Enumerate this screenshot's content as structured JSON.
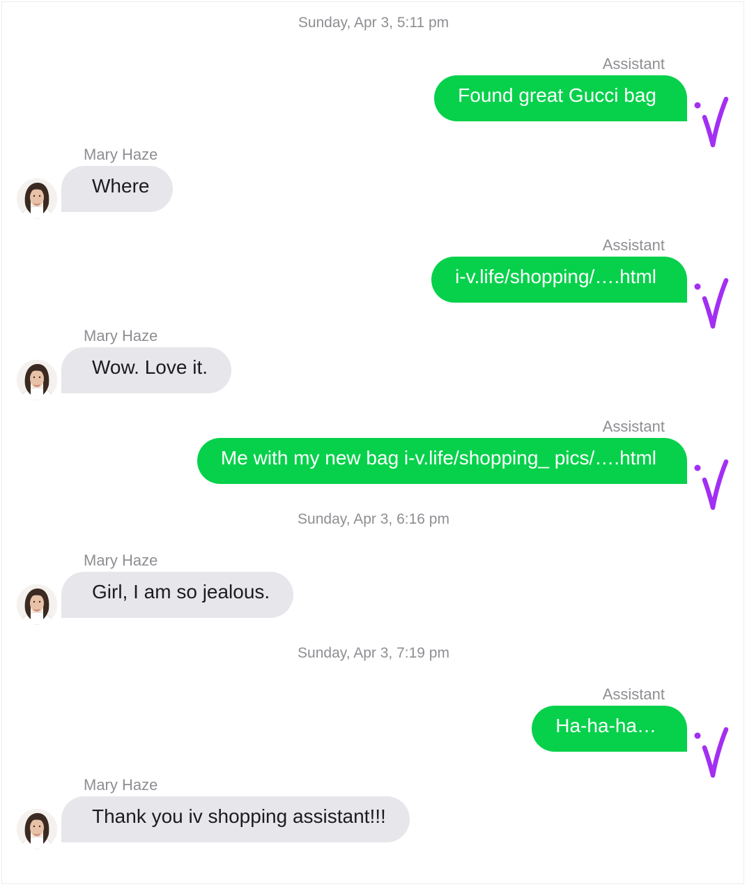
{
  "colors": {
    "outgoing_bubble": "#07d14b",
    "incoming_bubble": "#e6e6eb",
    "check_mark": "#a22ff2",
    "timestamp_text": "#8e8e93"
  },
  "conversation": {
    "timestamps": [
      "Sunday, Apr 3, 5:11 pm",
      "Sunday, Apr 3, 6:16 pm",
      "Sunday, Apr 3, 7:19 pm"
    ],
    "messages": [
      {
        "sender": "Assistant",
        "text": "Found great Gucci bag",
        "direction": "outgoing",
        "status_icon": "purple-check-icon"
      },
      {
        "sender": "Mary Haze",
        "text": "Where",
        "direction": "incoming",
        "avatar": "mary-haze-avatar"
      },
      {
        "sender": "Assistant",
        "text": "i-v.life/shopping/….html",
        "direction": "outgoing",
        "status_icon": "purple-check-icon"
      },
      {
        "sender": "Mary Haze",
        "text": "Wow. Love it.",
        "direction": "incoming",
        "avatar": "mary-haze-avatar"
      },
      {
        "sender": "Assistant",
        "text": "Me with my new bag i-v.life/shopping_ pics/….html",
        "direction": "outgoing",
        "status_icon": "purple-check-icon"
      },
      {
        "sender": "Mary Haze",
        "text": "Girl, I am so jealous.",
        "direction": "incoming",
        "avatar": "mary-haze-avatar"
      },
      {
        "sender": "Assistant",
        "text": "Ha-ha-ha…",
        "direction": "outgoing",
        "status_icon": "purple-check-icon"
      },
      {
        "sender": "Mary Haze",
        "text": "Thank you iv shopping assistant!!!",
        "direction": "incoming",
        "avatar": "mary-haze-avatar"
      }
    ]
  }
}
